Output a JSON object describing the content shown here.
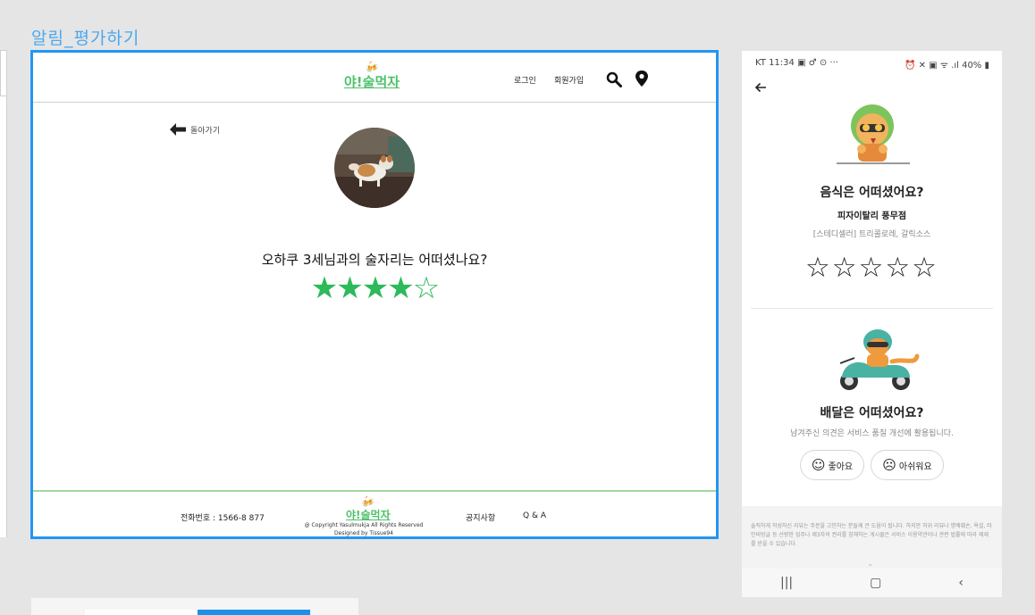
{
  "frame_title": "알림_평가하기",
  "desktop": {
    "header": {
      "logo_text": "야!술먹자",
      "logo_mugs": "🍻",
      "login": "로그인",
      "signup": "회원가입"
    },
    "back_label": "돌아가기",
    "question": "오하쿠 3세님과의 술자리는 어떠셨나요?",
    "rating": 4,
    "rating_max": 5,
    "stars_on": "★★★★",
    "stars_off": "☆",
    "footer": {
      "phone": "전화번호 :  1566-8 877",
      "logo_text": "야!술먹자",
      "logo_mugs": "🍻",
      "copyright": "@ Copyright Yasulmukja All Rights Reserved",
      "designer": "Designed by Tissue94",
      "notice": "공지사항",
      "qa": "Q & A"
    }
  },
  "phone": {
    "status_left": "KT 11:34 ▣ ♂ ⊙  ···",
    "status_right": "⏰ ✕ ▣ ᯤ .ıl 40% ▮",
    "food_title": "음식은 어떠셨어요?",
    "shop_name": "피자이탈리 풍무점",
    "menu": "[스테디셀러] 트리콜로레, 갈릭소스",
    "food_stars": "☆☆☆☆☆",
    "food_rating": 0,
    "delivery_title": "배달은 어떠셨어요?",
    "delivery_sub": "남겨주신 의견은 서비스 품질 개선에 활용됩니다.",
    "good_label": "좋아요",
    "bad_label": "아쉬워요",
    "good_face": "☺",
    "bad_face": "☹",
    "notice_text": "솔직하게 작성하신 리뷰는 주문을 고민하는 분들께 큰 도움이 됩니다. 하지만 허위 리뷰나 명예훼손, 욕설, 타인비방글 등 선량한 업주나 제3자의 권리를 침해하는 게시물은 서비스 이용약관이나 관련 법률에 따라 제재를 받을 수 있습니다.",
    "nav_recent": "|||",
    "nav_home": "▢",
    "nav_back": "‹"
  },
  "colors": {
    "accent_blue": "#2196f3",
    "star_green": "#2cba5b",
    "brand_green": "#4cc26a"
  }
}
